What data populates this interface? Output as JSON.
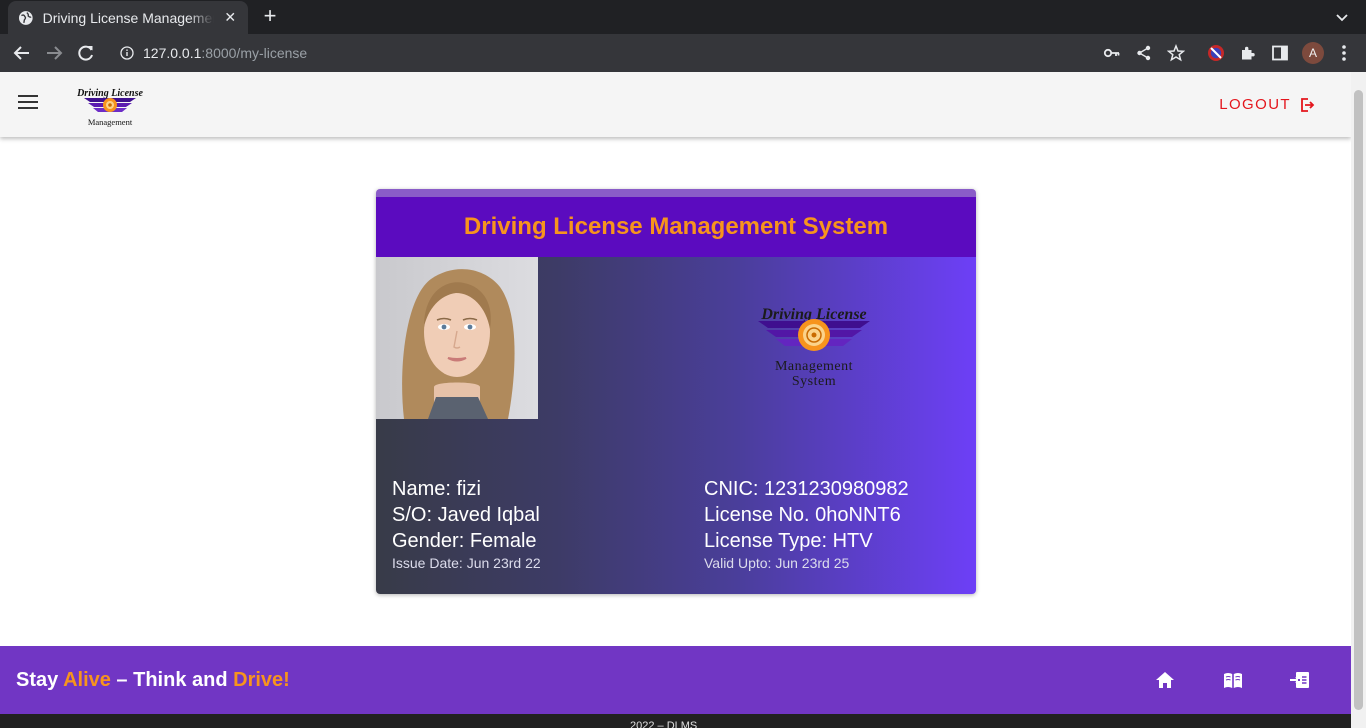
{
  "browser": {
    "tab_title": "Driving License Management System",
    "tab_close": "✕",
    "new_tab": "+",
    "url_host": "127.0.0.1",
    "url_path": ":8000/my-license",
    "profile_initial": "A"
  },
  "appbar": {
    "logout_label": "LOGOUT",
    "brand_line1": "Driving License",
    "brand_line2": "Management"
  },
  "card": {
    "title": "Driving License Management System",
    "logo_line1": "Driving License",
    "logo_line2": "Management",
    "logo_line3": "System",
    "name": "Name: fizi",
    "so": "S/O: Javed Iqbal",
    "gender": "Gender: Female",
    "issue_date": "Issue Date: Jun 23rd 22",
    "cnic": "CNIC: 1231230980982",
    "license_no": "License No. 0hoNNT6",
    "license_type": "License Type: HTV",
    "valid_upto": "Valid Upto: Jun 23rd 25"
  },
  "footer": {
    "slogan_part1": "Stay ",
    "slogan_part2": "Alive",
    "slogan_part3": " – Think and ",
    "slogan_part4": "Drive!",
    "icons": [
      "home-icon",
      "book-icon",
      "login-icon"
    ],
    "copyright": "2022 – DLMS"
  },
  "colors": {
    "accent_orange": "#f7941d",
    "header_purple": "#5b0bbf",
    "footer_purple": "#7136c4",
    "logout_red": "#e4161d"
  }
}
